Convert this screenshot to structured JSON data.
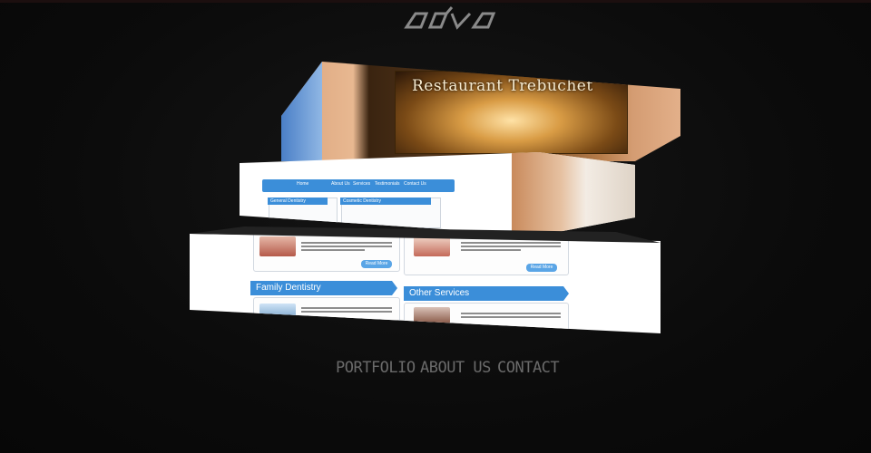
{
  "logo": {
    "text": "adva"
  },
  "restaurant": {
    "title": "Restaurant Trebuchet"
  },
  "dental_site": {
    "nav": [
      "Home",
      "About Us",
      "Services",
      "Testimonials",
      "Contact Us"
    ],
    "sections": {
      "general": "General Dentistry",
      "cosmetic": "Cosmetic Dentistry",
      "family": "Family Dentistry",
      "other": "Other Services"
    },
    "read_more": "Read More"
  },
  "menu": {
    "portfolio": "PORTFOLIO",
    "about": "ABOUT US",
    "contact": "CONTACT"
  },
  "colors": {
    "background": "#0b0b0b",
    "accent_blue": "#3b8ed9",
    "menu_text": "#6a6a6a"
  }
}
